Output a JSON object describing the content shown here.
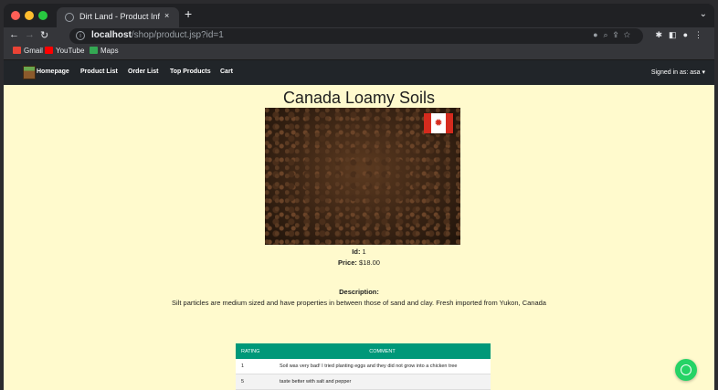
{
  "browser": {
    "tab_title": "Dirt Land - Product Information",
    "tab_close": "×",
    "new_tab": "+",
    "tab_menu": "⌄",
    "url_host": "localhost",
    "url_path": "/shop/product.jsp?id=1",
    "bookmarks": [
      {
        "label": "Gmail",
        "icon": "gmail-icon",
        "color": "#ea4335"
      },
      {
        "label": "YouTube",
        "icon": "youtube-icon",
        "color": "#ff0000"
      },
      {
        "label": "Maps",
        "icon": "maps-icon",
        "color": "#34a853"
      }
    ]
  },
  "nav": {
    "home": "Homepage",
    "product_list": "Product List",
    "order_list": "Order List",
    "top_products": "Top Products",
    "cart": "Cart",
    "signed_in": "Signed in as: asa ▾"
  },
  "product": {
    "name": "Canada Loamy Soils",
    "id_label": "Id:",
    "id_value": "1",
    "price_label": "Price:",
    "price_value": "$18.00",
    "description_label": "Description:",
    "description": "Silt particles are medium sized and have properties in between those of sand and clay. Fresh imported from Yukon, Canada"
  },
  "reviews": {
    "headers": [
      "RATING",
      "COMMENT"
    ],
    "rows": [
      {
        "rating": "1",
        "comment": "Soil was very bad! I tried planting eggs and they did not grow into a chicken tree"
      },
      {
        "rating": "5",
        "comment": "taste better with salt and pepper"
      }
    ]
  },
  "colors": {
    "page_bg": "#fffacd",
    "nav_bg": "#212529",
    "table_header": "#009879",
    "whatsapp": "#25d366"
  }
}
